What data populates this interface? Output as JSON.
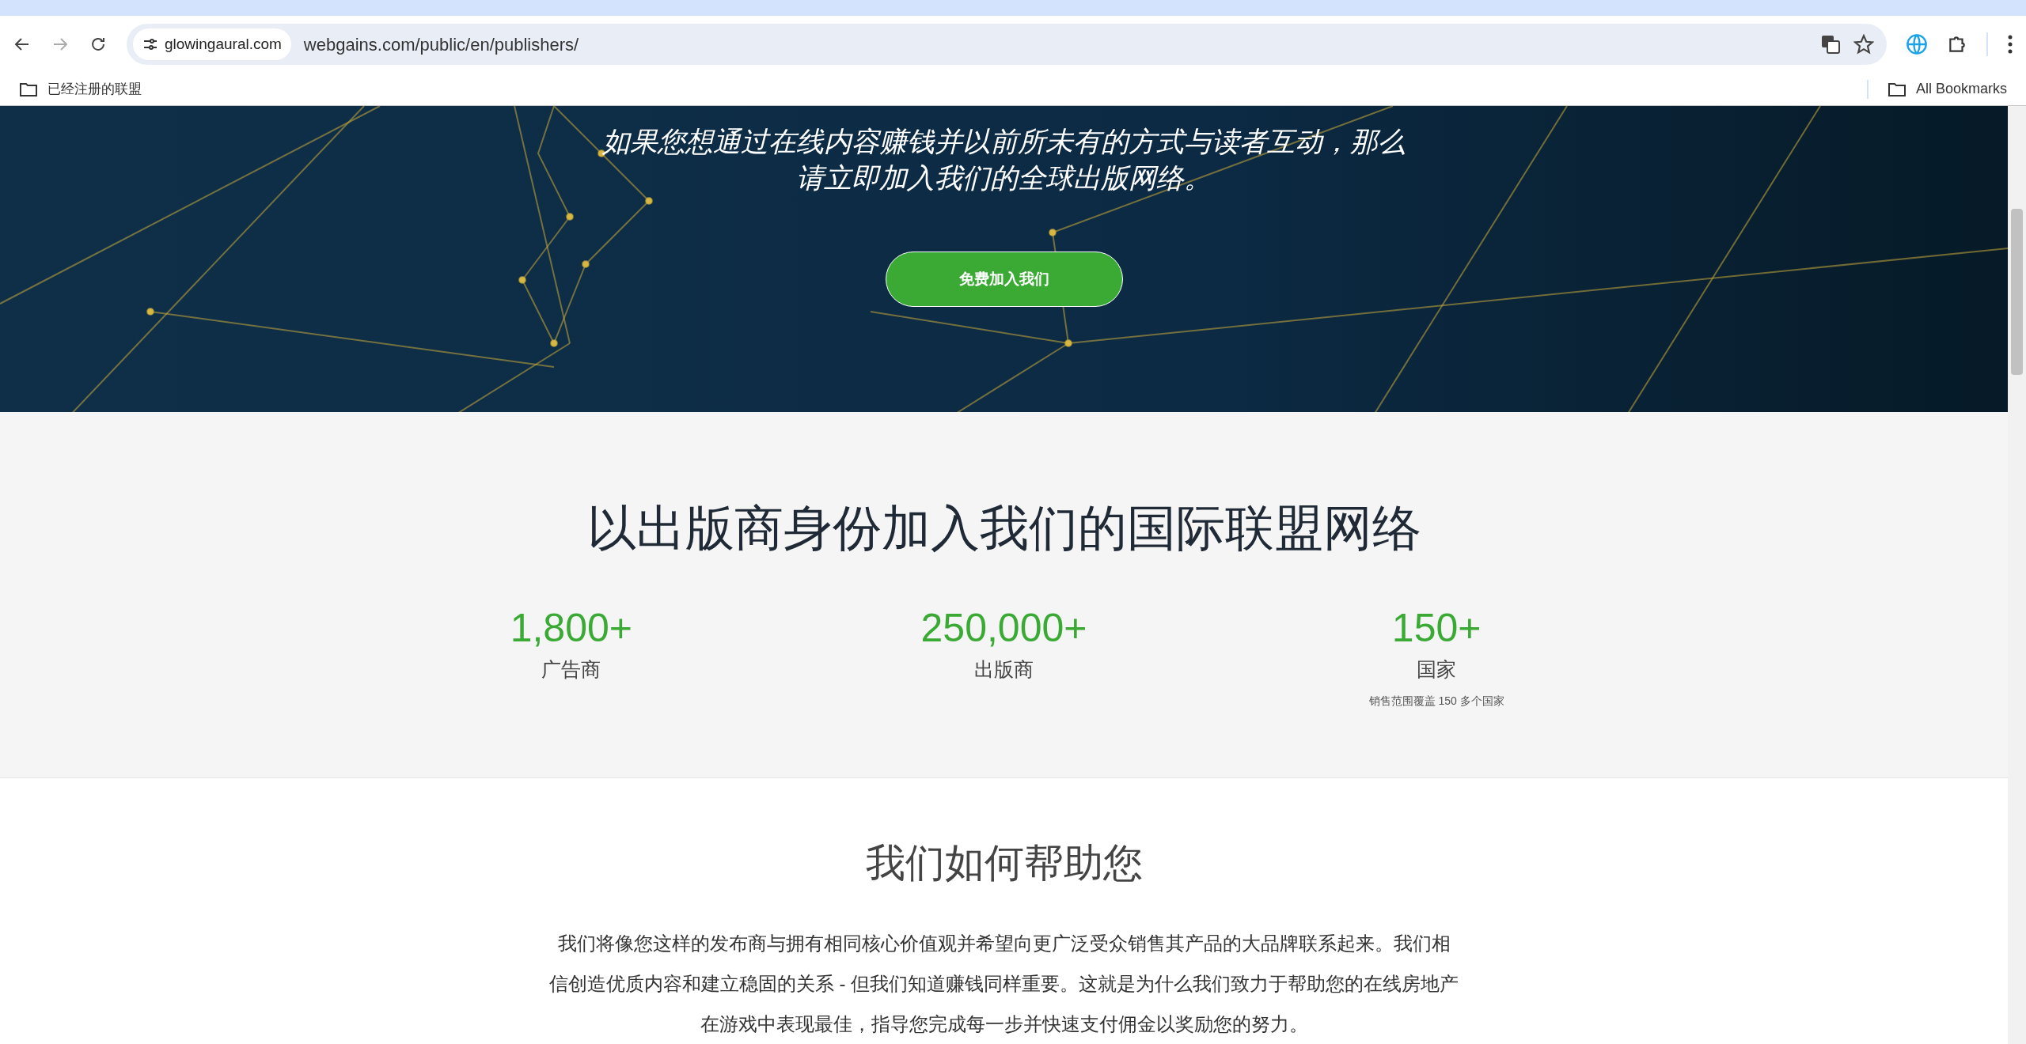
{
  "browser": {
    "site_chip": "glowingaural.com",
    "url": "webgains.com/public/en/publishers/",
    "bookmarks": [
      {
        "label": "已经注册的联盟"
      }
    ],
    "all_bookmarks": "All Bookmarks"
  },
  "hero": {
    "lines": [
      "如果您想通过在线内容赚钱并以前所未有的方式与读者互动，那么",
      "请立即加入我们的全球出版网络。"
    ],
    "button": "免费加入我们"
  },
  "network": {
    "title": "以出版商身份加入我们的国际联盟网络",
    "stats": [
      {
        "value": "1,800+",
        "label": "广告商"
      },
      {
        "value": "250,000+",
        "label": "出版商"
      },
      {
        "value": "150+",
        "label": "国家",
        "note": "销售范围覆盖 150 多个国家"
      }
    ]
  },
  "help": {
    "title": "我们如何帮助您",
    "paragraph": "我们将像您这样的发布商与拥有相同核心价值观并希望向更广泛受众销售其产品的大品牌联系起来。我们相信创造优质内容和建立稳固的关系 - 但我们知道赚钱同样重要。这就是为什么我们致力于帮助您的在线房地产在游戏中表现最佳，指导您完成每一步并快速支付佣金以奖励您的努力。"
  }
}
